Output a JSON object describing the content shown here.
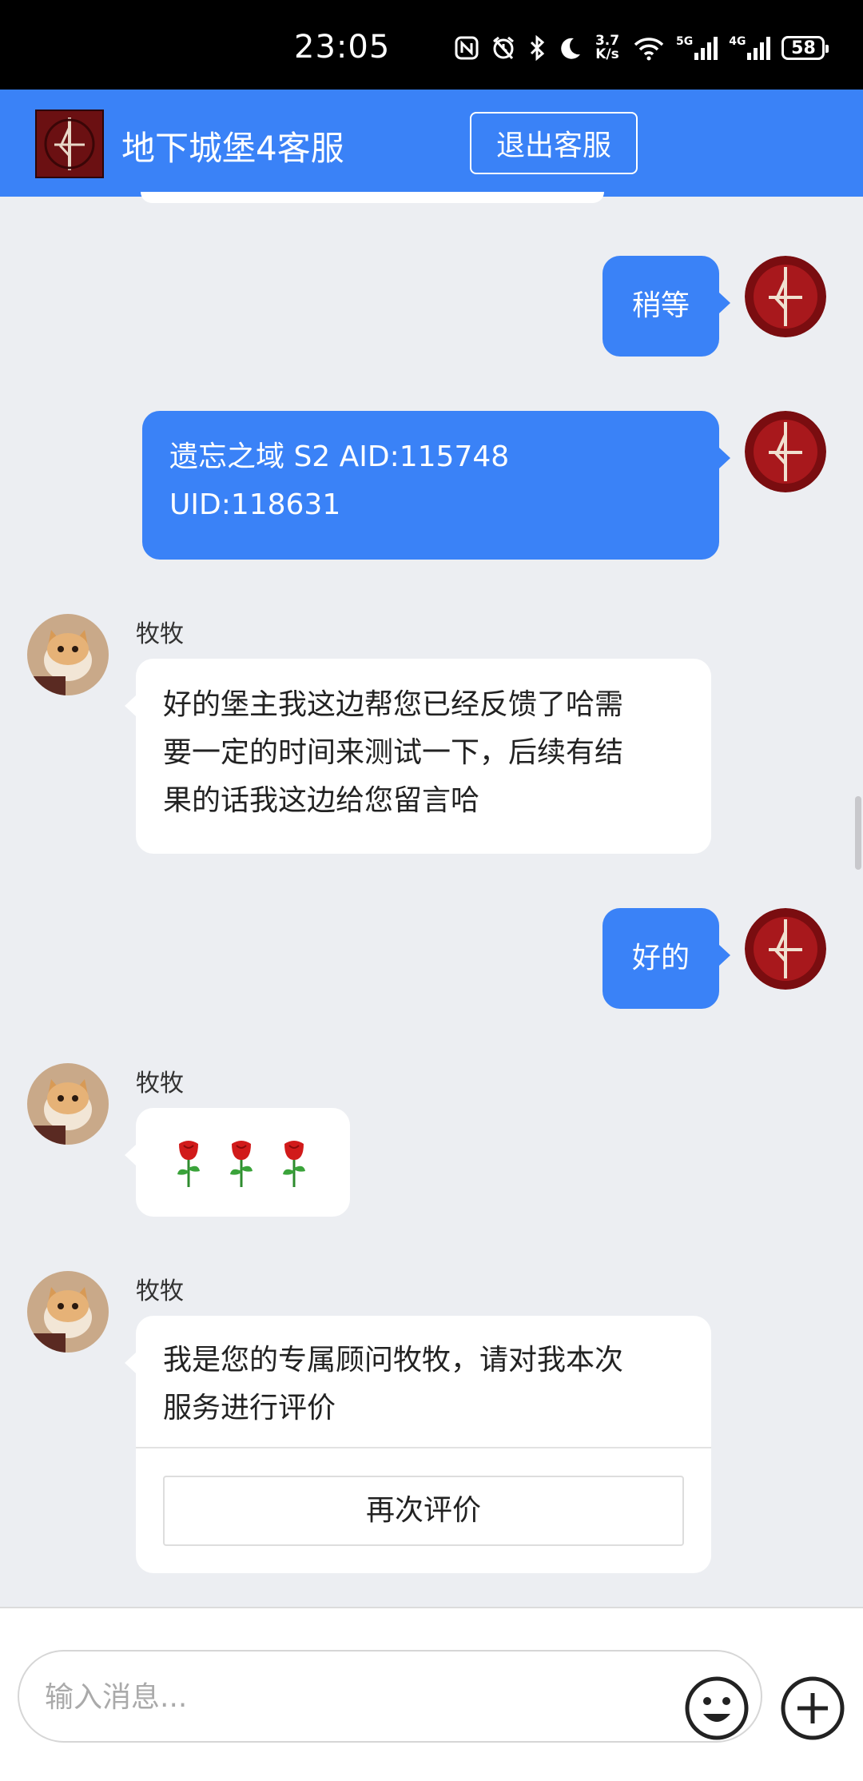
{
  "status_bar": {
    "time": "23:05",
    "speed_value": "3.7",
    "speed_unit": "K/s",
    "net1": "5G",
    "net2": "4G",
    "battery": "58"
  },
  "header": {
    "title": "地下城堡4客服",
    "exit_label": "退出客服"
  },
  "messages": {
    "m1": {
      "text": "稍等"
    },
    "m2": {
      "line1": "遗忘之域 S2 AID:115748",
      "line2": "UID:118631"
    },
    "m3": {
      "name": "牧牧",
      "line1": "好的堡主我这边帮您已经反馈了哈需",
      "line2": "要一定的时间来测试一下，后续有结",
      "line3": "果的话我这边给您留言哈"
    },
    "m4": {
      "text": "好的"
    },
    "m5": {
      "name": "牧牧",
      "roses": "🌹🌹🌹"
    },
    "m6": {
      "name": "牧牧",
      "line1": "我是您的专属顾问牧牧，请对我本次",
      "line2": "服务进行评价",
      "button": "再次评价"
    }
  },
  "input": {
    "placeholder": "输入消息..."
  },
  "colors": {
    "accent": "#3a82f7",
    "chat_bg": "#eceef2",
    "bubble_left": "#ffffff"
  },
  "icons": [
    "nfc-icon",
    "alarm-icon",
    "bluetooth-icon",
    "moon-icon",
    "wifi-icon",
    "signal-icon",
    "battery-icon",
    "game-logo-icon",
    "emoji-icon",
    "plus-icon"
  ]
}
